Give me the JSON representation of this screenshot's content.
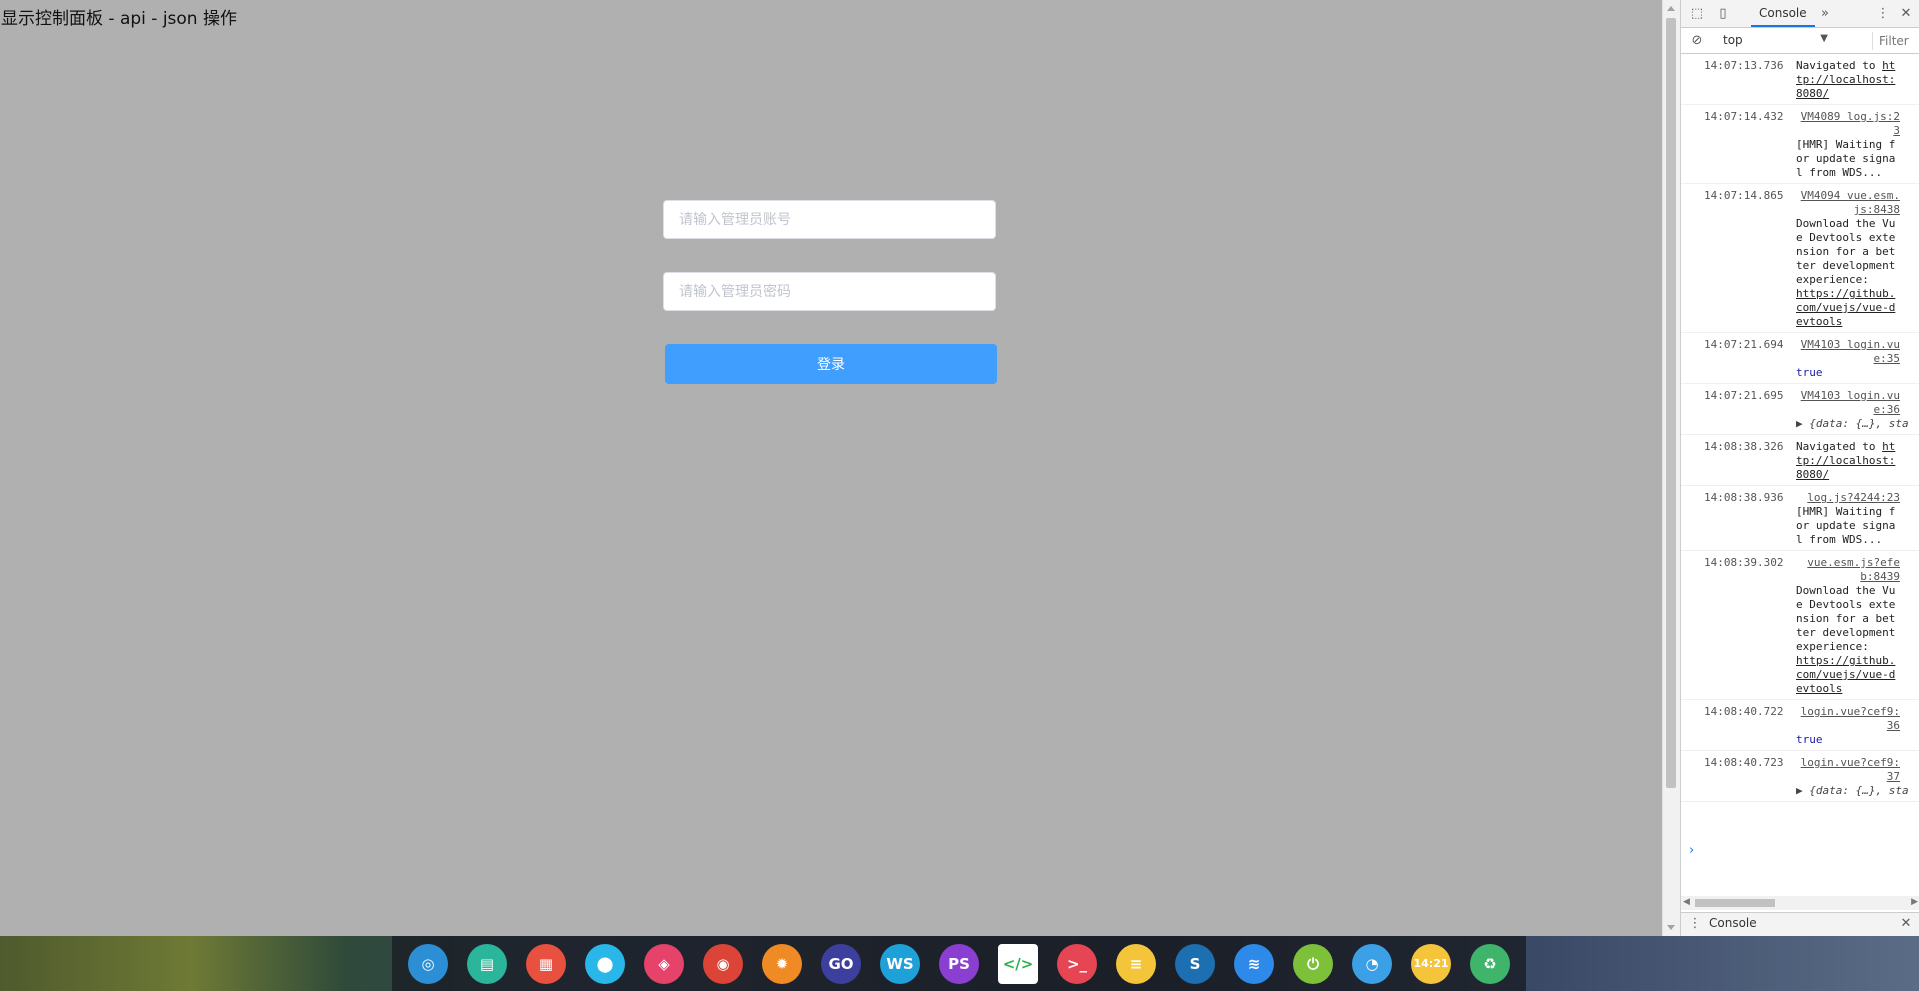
{
  "page": {
    "heading": "显示控制面板 - api - json 操作",
    "login": {
      "account_placeholder": "请输入管理员账号",
      "password_placeholder": "请输入管理员密码",
      "submit_label": "登录"
    }
  },
  "devtools": {
    "tab_console": "Console",
    "context": "top",
    "filter_placeholder": "Filter",
    "drawer_tab": "Console",
    "logs": [
      {
        "time": "14:07:13.736",
        "source": "",
        "lines": [
          "Navigated to "
        ],
        "link": "http://localhost:8080/",
        "type": "nav"
      },
      {
        "time": "14:07:14.432",
        "source": "VM4089 log.js:23",
        "lines": [
          "[HMR] Waiting for update signal from WDS..."
        ],
        "link": "",
        "type": "text"
      },
      {
        "time": "14:07:14.865",
        "source": "VM4094 vue.esm.js:8438",
        "lines": [
          "Download the Vue Devtools extension for a better development experience:"
        ],
        "link": "https://github.com/vuejs/vue-devtools",
        "type": "text"
      },
      {
        "time": "14:07:21.694",
        "source": "VM4103 login.vue:35",
        "lines": [
          "true"
        ],
        "link": "",
        "type": "bool"
      },
      {
        "time": "14:07:21.695",
        "source": "VM4103 login.vue:36",
        "lines": [
          "▶ {data: {…}, sta"
        ],
        "link": "",
        "type": "obj"
      },
      {
        "time": "14:08:38.326",
        "source": "",
        "lines": [
          "Navigated to "
        ],
        "link": "http://localhost:8080/",
        "type": "nav"
      },
      {
        "time": "14:08:38.936",
        "source": "log.js?4244:23",
        "lines": [
          "[HMR] Waiting for update signal from WDS..."
        ],
        "link": "",
        "type": "text"
      },
      {
        "time": "14:08:39.302",
        "source": "vue.esm.js?efeb:8439",
        "lines": [
          "Download the Vue Devtools extension for a better development experience:"
        ],
        "link": "https://github.com/vuejs/vue-devtools",
        "type": "text"
      },
      {
        "time": "14:08:40.722",
        "source": "login.vue?cef9:36",
        "lines": [
          "true"
        ],
        "link": "",
        "type": "bool"
      },
      {
        "time": "14:08:40.723",
        "source": "login.vue?cef9:37",
        "lines": [
          "▶ {data: {…}, sta"
        ],
        "link": "",
        "type": "obj"
      }
    ]
  },
  "dock": {
    "apps": [
      {
        "name": "deepin-launcher-icon",
        "glyph": "◎",
        "color": "#2c8fd6"
      },
      {
        "name": "app-store-icon",
        "glyph": "▤",
        "color": "#2bb59a"
      },
      {
        "name": "multitasking-icon",
        "glyph": "▦",
        "color": "#e8503f"
      },
      {
        "name": "map-icon",
        "glyph": "⬤",
        "color": "#29b6e8"
      },
      {
        "name": "shopping-bag-icon",
        "glyph": "◈",
        "color": "#e6436a"
      },
      {
        "name": "chrome-icon",
        "glyph": "◉",
        "color": "#db4437"
      },
      {
        "name": "settings-gear-icon",
        "glyph": "✹",
        "color": "#f08a24"
      },
      {
        "name": "goland-icon",
        "glyph": "GO",
        "color": "#3d3f9e"
      },
      {
        "name": "webstorm-icon",
        "glyph": "WS",
        "color": "#1ea0d8"
      },
      {
        "name": "phpstorm-icon",
        "glyph": "PS",
        "color": "#8b3fd1"
      },
      {
        "name": "code-editor-icon",
        "glyph": "</>",
        "color": "#ffffff"
      },
      {
        "name": "terminal-icon",
        "glyph": ">_",
        "color": "#e64553"
      },
      {
        "name": "notes-icon",
        "glyph": "≡",
        "color": "#f4c43a"
      },
      {
        "name": "sublime-icon",
        "glyph": "S",
        "color": "#1c6fb0"
      },
      {
        "name": "wifi-icon",
        "glyph": "≋",
        "color": "#2d8ae8"
      },
      {
        "name": "power-icon",
        "glyph": "⏻",
        "color": "#7dc13a"
      },
      {
        "name": "timer-icon",
        "glyph": "◔",
        "color": "#3ba0e6"
      },
      {
        "name": "clock-icon",
        "glyph": "14:21",
        "color": "#f4c43a"
      },
      {
        "name": "trash-icon",
        "glyph": "♻",
        "color": "#3fb56b"
      }
    ]
  }
}
